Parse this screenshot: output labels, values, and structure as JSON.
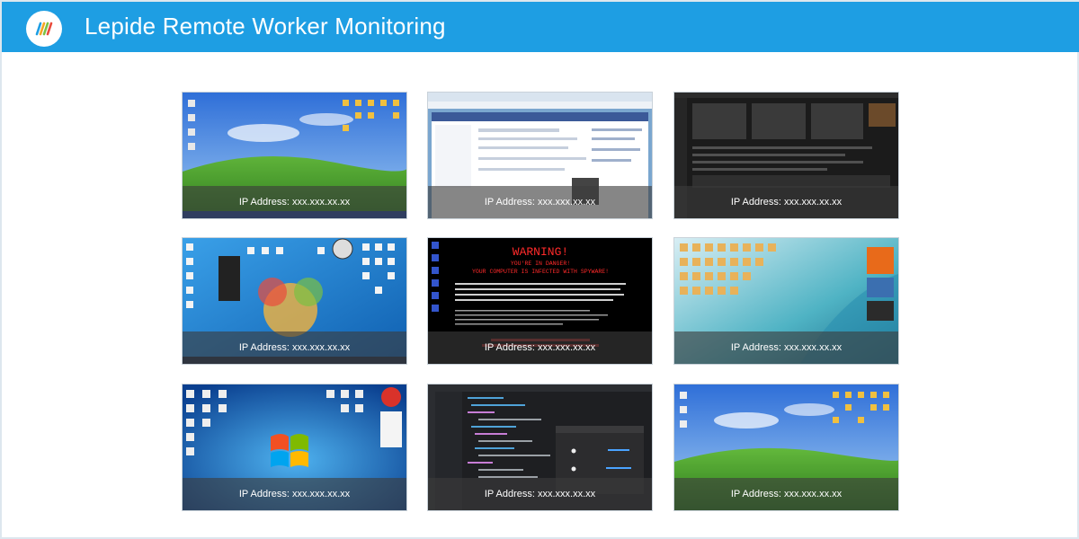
{
  "app": {
    "title": "Lepide Remote Worker Monitoring",
    "logo_icon": "lepide-logo-icon"
  },
  "colors": {
    "header": "#1e9ee3",
    "overlay": "#3c3c3c"
  },
  "workstations": [
    {
      "scene": "xp-bliss-desktop",
      "ip_label": "IP Address: xxx.xxx.xx.xx"
    },
    {
      "scene": "facebook-browser",
      "ip_label": "IP Address: xxx.xxx.xx.xx"
    },
    {
      "scene": "dark-media-app",
      "ip_label": "IP Address: xxx.xxx.xx.xx"
    },
    {
      "scene": "cluttered-desktop",
      "ip_label": "IP Address: xxx.xxx.xx.xx"
    },
    {
      "scene": "spyware-warning",
      "ip_label": "IP Address: xxx.xxx.xx.xx",
      "warning": {
        "headline": "WARNING!",
        "line1": "YOU'RE IN DANGER!",
        "line2": "YOUR COMPUTER IS INFECTED WITH SPYWARE!"
      }
    },
    {
      "scene": "win7-icons-desktop",
      "ip_label": "IP Address: xxx.xxx.xx.xx"
    },
    {
      "scene": "win7-desktop",
      "ip_label": "IP Address: xxx.xxx.xx.xx"
    },
    {
      "scene": "code-editor",
      "ip_label": "IP Address: xxx.xxx.xx.xx"
    },
    {
      "scene": "xp-bliss-desktop",
      "ip_label": "IP Address: xxx.xxx.xx.xx"
    }
  ]
}
